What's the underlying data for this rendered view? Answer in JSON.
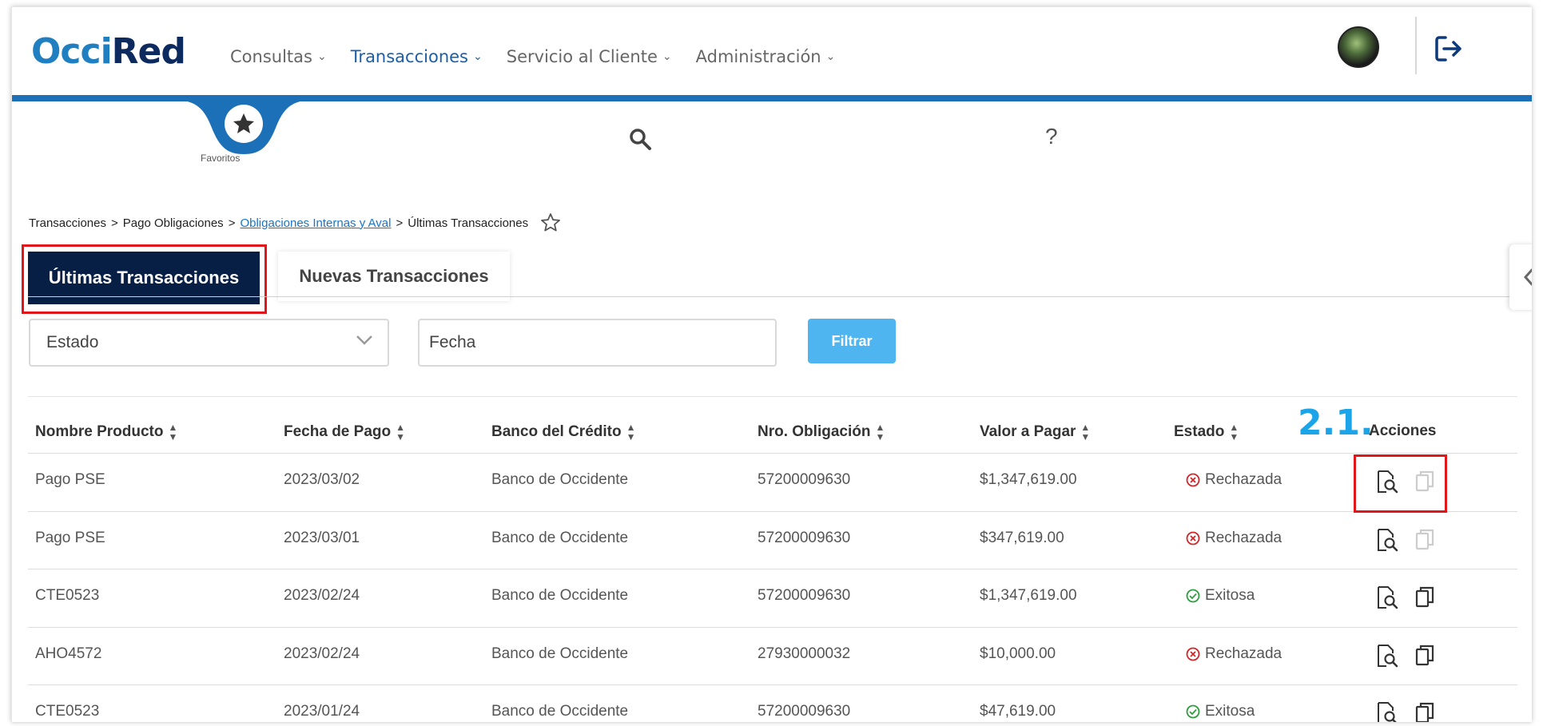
{
  "header": {
    "logo_part1": "Occi",
    "logo_part2": "Red",
    "nav": [
      {
        "label": "Consultas",
        "active": false
      },
      {
        "label": "Transacciones",
        "active": true
      },
      {
        "label": "Servicio al Cliente",
        "active": false
      },
      {
        "label": "Administración",
        "active": false
      }
    ]
  },
  "subbar": {
    "favorites_label": "Favoritos",
    "help_glyph": "?"
  },
  "breadcrumb": {
    "items": [
      "Transacciones",
      "Pago Obligaciones",
      "Obligaciones Internas y Aval",
      "Últimas Transacciones"
    ],
    "separator": ">"
  },
  "tabs": [
    {
      "label": "Últimas Transacciones",
      "active": true
    },
    {
      "label": "Nuevas Transacciones",
      "active": false
    }
  ],
  "filters": {
    "status_value": "Estado",
    "date_value": "Fecha",
    "filter_button": "Filtrar"
  },
  "annotation": {
    "step": "2.1."
  },
  "table": {
    "headers": [
      "Nombre Producto",
      "Fecha de Pago",
      "Banco del Crédito",
      "Nro. Obligación",
      "Valor a Pagar",
      "Estado",
      "Acciones"
    ],
    "rows": [
      {
        "product": "Pago PSE",
        "date": "2023/03/02",
        "bank": "Banco de Occidente",
        "obligation": "57200009630",
        "amount": "$1,347,619.00",
        "status": "Rechazada",
        "ok": false
      },
      {
        "product": "Pago PSE",
        "date": "2023/03/01",
        "bank": "Banco de Occidente",
        "obligation": "57200009630",
        "amount": "$347,619.00",
        "status": "Rechazada",
        "ok": false
      },
      {
        "product": "CTE0523",
        "date": "2023/02/24",
        "bank": "Banco de Occidente",
        "obligation": "57200009630",
        "amount": "$1,347,619.00",
        "status": "Exitosa",
        "ok": true
      },
      {
        "product": "AHO4572",
        "date": "2023/02/24",
        "bank": "Banco de Occidente",
        "obligation": "27930000032",
        "amount": "$10,000.00",
        "status": "Rechazada",
        "ok": false
      },
      {
        "product": "CTE0523",
        "date": "2023/01/24",
        "bank": "Banco de Occidente",
        "obligation": "57200009630",
        "amount": "$47,619.00",
        "status": "Exitosa",
        "ok": true
      }
    ]
  },
  "colors": {
    "brand_blue": "#1c70b8",
    "tab_active": "#071f44",
    "filter_button": "#4fb5f0",
    "highlight": "#e0161b",
    "rejected": "#d0272a",
    "success": "#2e9e3e",
    "annotation": "#1ca4e8"
  },
  "icons": [
    "star-icon",
    "search-icon",
    "help-icon",
    "logout-icon",
    "chevron-down-icon",
    "sort-icon",
    "view-details-icon",
    "copy-icon",
    "rejected-icon",
    "success-icon",
    "chevron-left-icon"
  ]
}
